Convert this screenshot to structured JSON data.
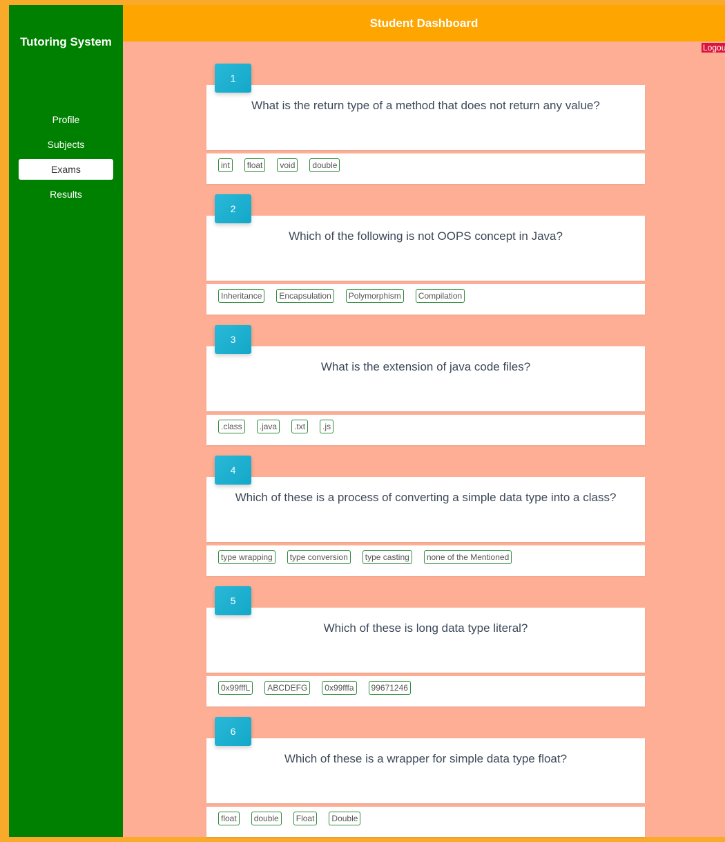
{
  "sidebar": {
    "brand": "Tutoring System",
    "items": [
      {
        "label": "Profile",
        "active": false
      },
      {
        "label": "Subjects",
        "active": false
      },
      {
        "label": "Exams",
        "active": true
      },
      {
        "label": "Results",
        "active": false
      }
    ]
  },
  "header": {
    "title": "Student Dashboard",
    "logout_label": "Logout"
  },
  "colors": {
    "sidebar": "#008000",
    "topbar": "#ffa500",
    "content_bg": "#fdae94",
    "question_badge": "#1ab0d0",
    "logout": "#dc143c",
    "option_border": "#2e8b3a"
  },
  "questions": [
    {
      "number": "1",
      "text": "What is the return type of a method that does not return any value?",
      "options": [
        "int",
        "float",
        "void",
        "double"
      ]
    },
    {
      "number": "2",
      "text": "Which of the following is not OOPS concept in Java?",
      "options": [
        "Inheritance",
        "Encapsulation",
        "Polymorphism",
        "Compilation"
      ]
    },
    {
      "number": "3",
      "text": "What is the extension of java code files?",
      "options": [
        ".class",
        ".java",
        ".txt",
        ".js"
      ]
    },
    {
      "number": "4",
      "text": "Which of these is a process of converting a simple data type into a class?",
      "options": [
        "type wrapping",
        "type conversion",
        "type casting",
        "none of the Mentioned"
      ]
    },
    {
      "number": "5",
      "text": "Which of these is long data type literal?",
      "options": [
        "0x99fffL",
        "ABCDEFG",
        "0x99fffa",
        "99671246"
      ]
    },
    {
      "number": "6",
      "text": "Which of these is a wrapper for simple data type float?",
      "options": [
        "float",
        "double",
        "Float",
        "Double"
      ]
    }
  ]
}
